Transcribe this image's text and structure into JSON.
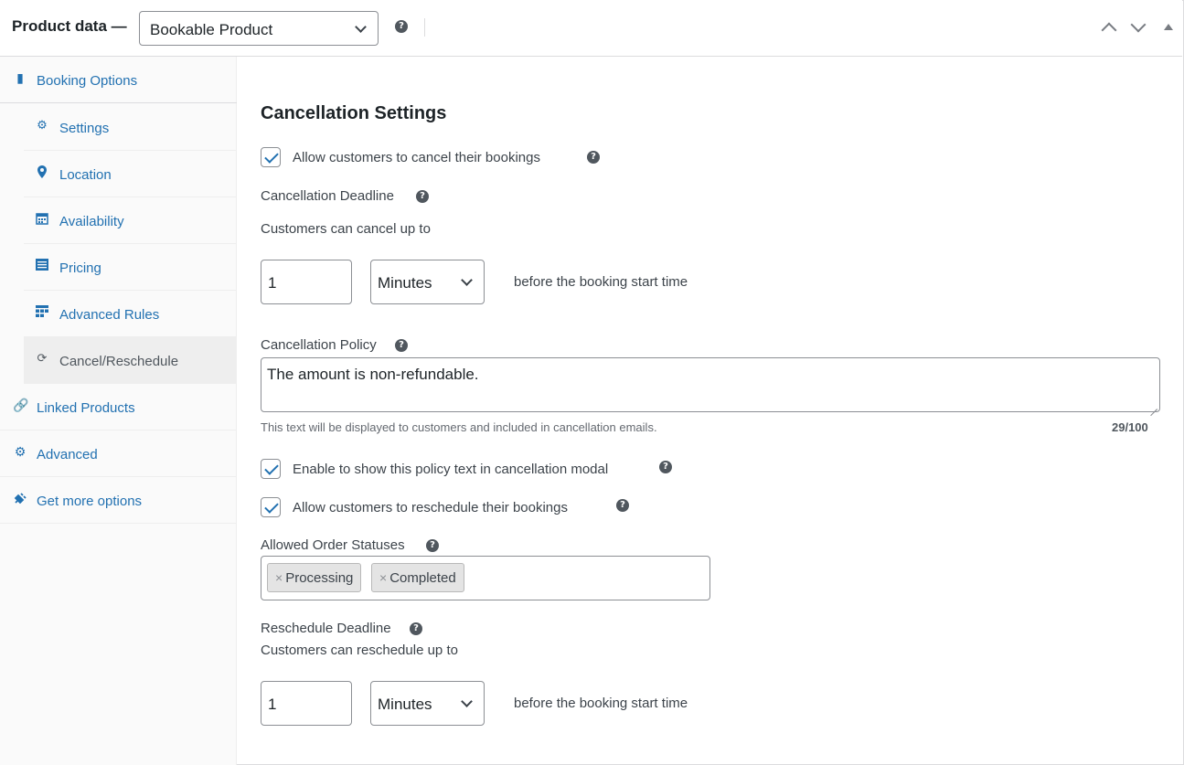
{
  "header": {
    "title": "Product data —",
    "product_type": "Bookable Product",
    "help": "?"
  },
  "sidebar": {
    "items": [
      {
        "label": "Booking Options",
        "icon": "book-icon"
      },
      {
        "label": "Settings",
        "icon": "gear-icon"
      },
      {
        "label": "Location",
        "icon": "map-pin-icon"
      },
      {
        "label": "Availability",
        "icon": "calendar-icon"
      },
      {
        "label": "Pricing",
        "icon": "list-icon"
      },
      {
        "label": "Advanced Rules",
        "icon": "table-icon"
      },
      {
        "label": "Cancel/Reschedule",
        "icon": "refresh-icon"
      },
      {
        "label": "Linked Products",
        "icon": "link-icon"
      },
      {
        "label": "Advanced",
        "icon": "gear-icon"
      },
      {
        "label": "Get more options",
        "icon": "plugin-icon"
      }
    ]
  },
  "main": {
    "section_title": "Cancellation Settings",
    "allow_cancel_label": "Allow customers to cancel their bookings",
    "cancellation_deadline_label": "Cancellation Deadline",
    "cancel_up_to_text": "Customers can cancel up to",
    "cancel_value": "1",
    "cancel_unit": "Minutes",
    "before_start_text": "before the booking start time",
    "cancellation_policy_label": "Cancellation Policy",
    "policy_text": "The amount is non-refundable.",
    "policy_description": "This text will be displayed to customers and included in cancellation emails.",
    "policy_counter": "29/100",
    "show_policy_label": "Enable to show this policy text in cancellation modal",
    "allow_reschedule_label": "Allow customers to reschedule their bookings",
    "allowed_statuses_label": "Allowed Order Statuses",
    "statuses": [
      "Processing",
      "Completed"
    ],
    "tag_remove": "×",
    "reschedule_deadline_label": "Reschedule Deadline",
    "reschedule_up_to_text": "Customers can reschedule up to",
    "reschedule_value": "1",
    "reschedule_unit": "Minutes"
  },
  "colors": {
    "link": "#2271b1",
    "active_bg": "#eeeeee",
    "border": "#8c8f94"
  }
}
